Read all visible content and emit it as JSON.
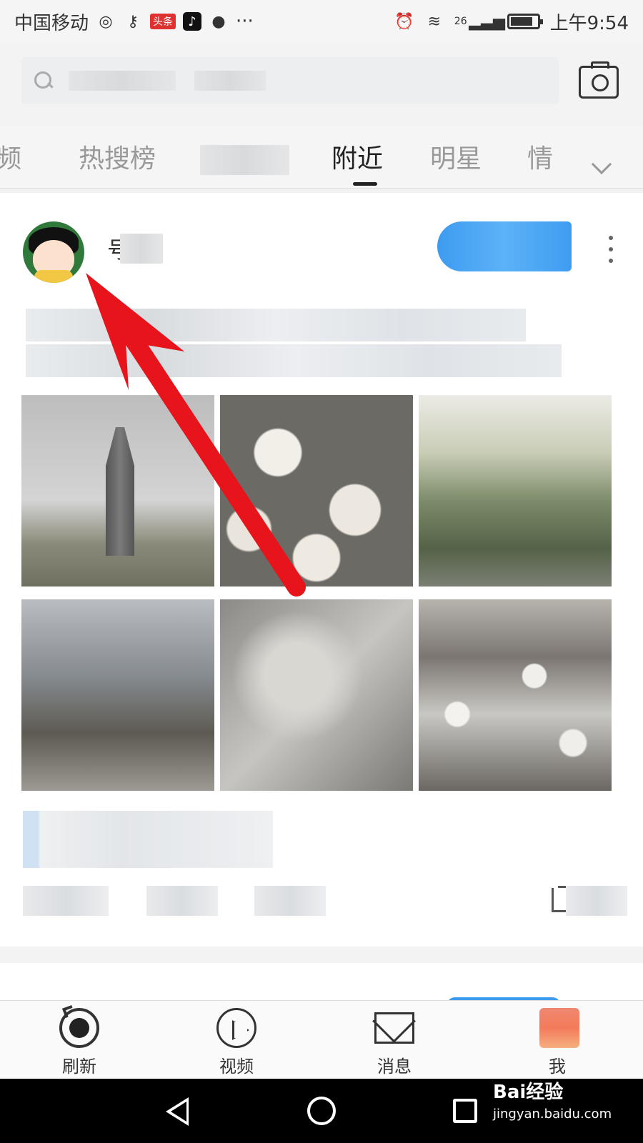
{
  "status_bar": {
    "carrier": "中国移动",
    "app_badge": "头条",
    "more": "···",
    "signal": "26",
    "time": "上午9:54"
  },
  "search": {
    "placeholder": ""
  },
  "tabs": [
    {
      "label": "频"
    },
    {
      "label": "热搜榜"
    },
    {
      "label": ""
    },
    {
      "label": "附近"
    },
    {
      "label": "明星"
    },
    {
      "label": "情"
    }
  ],
  "post": {
    "username": "号",
    "follow_label": ""
  },
  "bottom_nav": [
    {
      "label": "刷新"
    },
    {
      "label": "视频"
    },
    {
      "label": "消息"
    },
    {
      "label": "我"
    }
  ],
  "watermark": {
    "brand": "Bai经验",
    "url": "jingyan.baidu.com"
  },
  "colors": {
    "accent_blue": "#3d9bf0",
    "arrow_red": "#e8141c"
  }
}
